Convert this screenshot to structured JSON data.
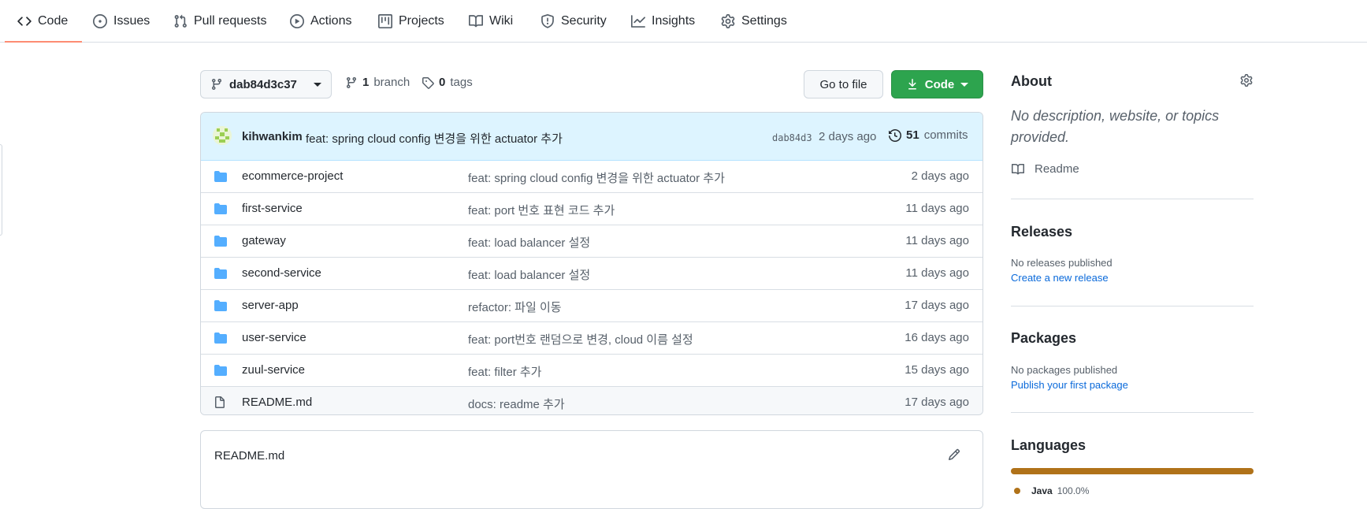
{
  "tabs": [
    {
      "label": "Code",
      "icon": "code-icon",
      "active": true
    },
    {
      "label": "Issues",
      "icon": "issue-icon"
    },
    {
      "label": "Pull requests",
      "icon": "pull-request-icon"
    },
    {
      "label": "Actions",
      "icon": "play-icon"
    },
    {
      "label": "Projects",
      "icon": "table-icon"
    },
    {
      "label": "Wiki",
      "icon": "book-icon"
    },
    {
      "label": "Security",
      "icon": "shield-icon"
    },
    {
      "label": "Insights",
      "icon": "graph-icon"
    },
    {
      "label": "Settings",
      "icon": "gear-icon"
    }
  ],
  "toolbar": {
    "branch": "dab84d3c37",
    "branch_count": "1",
    "branch_label": "branch",
    "tag_count": "0",
    "tag_label": "tags",
    "goto_file": "Go to file",
    "code_label": "Code"
  },
  "commit": {
    "author": "kihwankim",
    "message": "feat: spring cloud config 변경을 위한 actuator 추가",
    "sha": "dab84d3",
    "age": "2 days ago",
    "count": "51",
    "count_label": "commits"
  },
  "files": [
    {
      "type": "folder",
      "name": "ecommerce-project",
      "message": "feat: spring cloud config 변경을 위한 actuator 추가",
      "age": "2 days ago"
    },
    {
      "type": "folder",
      "name": "first-service",
      "message": "feat: port 번호 표현 코드 추가",
      "age": "11 days ago"
    },
    {
      "type": "folder",
      "name": "gateway",
      "message": "feat: load balancer 설정",
      "age": "11 days ago"
    },
    {
      "type": "folder",
      "name": "second-service",
      "message": "feat: load balancer 설정",
      "age": "11 days ago"
    },
    {
      "type": "folder",
      "name": "server-app",
      "message": "refactor: 파일 이동",
      "age": "17 days ago"
    },
    {
      "type": "folder",
      "name": "user-service",
      "message": "feat: port번호 랜덤으로 변경, cloud 이름 설정",
      "age": "16 days ago"
    },
    {
      "type": "folder",
      "name": "zuul-service",
      "message": "feat: filter 추가",
      "age": "15 days ago"
    },
    {
      "type": "file",
      "name": "README.md",
      "message": "docs: readme 추가",
      "age": "17 days ago"
    }
  ],
  "readme": {
    "title": "README.md"
  },
  "about": {
    "title": "About",
    "description": "No description, website, or topics provided.",
    "readme_link": "Readme"
  },
  "releases": {
    "title": "Releases",
    "status": "No releases published",
    "link": "Create a new release"
  },
  "packages": {
    "title": "Packages",
    "status": "No packages published",
    "link": "Publish your first package"
  },
  "languages": {
    "title": "Languages",
    "items": [
      {
        "name": "Java",
        "percent": "100.0%",
        "color": "#b07219",
        "share": 100.0
      }
    ]
  },
  "colors": {
    "accent_green": "#2da44e",
    "link_blue": "#0969da",
    "tab_underline": "#fd8c73",
    "commit_bar_bg": "#ddf4ff"
  }
}
